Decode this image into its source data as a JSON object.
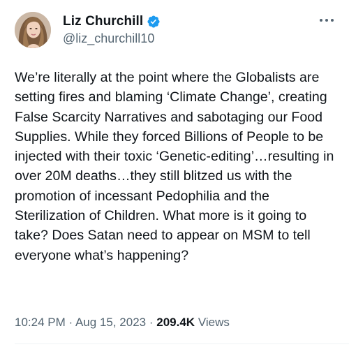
{
  "tweet": {
    "author": {
      "display_name": "Liz Churchill",
      "handle": "@liz_churchill10",
      "verified": true,
      "avatar_icon": "profile-photo"
    },
    "text": "We’re literally at the point where the Globalists are setting fires and blaming ‘Climate Change’, creating False Scarcity Narratives and sabotaging our Food Supplies. While they forced Billions of People to be injected with their toxic ‘Genetic-editing’…resulting in over 20M deaths…they still blitzed us with the promotion of incessant Pedophilia and the Sterilization of Children. What more is it going to take? Does Satan need to appear on MSM to tell everyone what’s happening?",
    "time": "10:24 PM",
    "separator": "·",
    "date": "Aug 15, 2023",
    "views_count": "209.4K",
    "views_label": "Views",
    "more_icon": "more-options-icon"
  },
  "colors": {
    "text_primary": "#0f1419",
    "text_secondary": "#536471",
    "verified_blue": "#1d9bf0",
    "divider": "#eff3f4"
  }
}
